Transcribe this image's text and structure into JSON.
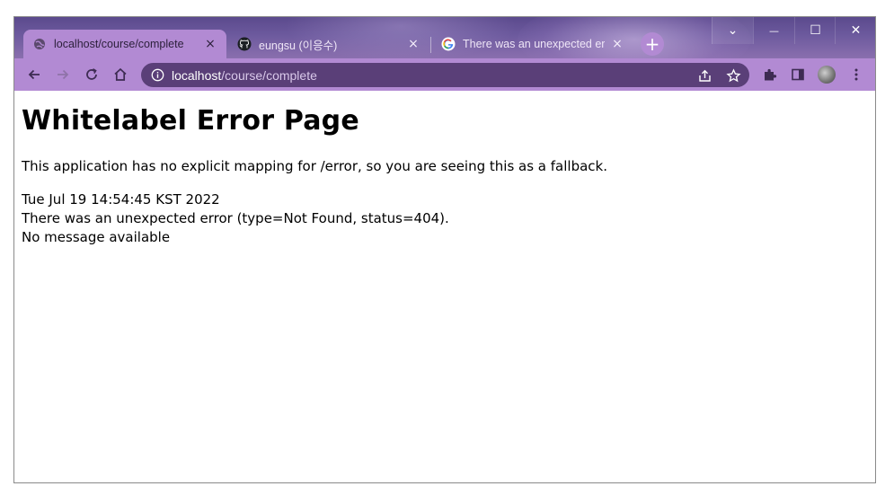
{
  "browser": {
    "tabs": [
      {
        "title": "localhost/course/complete",
        "close": "×",
        "favicon": "globe-icon",
        "active": true
      },
      {
        "title": "eungsu (이응수)",
        "close": "×",
        "favicon": "github-icon",
        "active": false
      },
      {
        "title": "There was an unexpected erro",
        "close": "×",
        "favicon": "google-icon",
        "active": false
      }
    ],
    "new_tab": "+",
    "window_controls": {
      "tab_search": "⌄",
      "minimize": "—",
      "maximize": "☐",
      "close": "✕"
    },
    "address": {
      "host": "localhost",
      "path": "/course/complete"
    },
    "colors": {
      "frame": "#6d5a9e",
      "toolbar": "#b28ad3",
      "omnibox": "#5a3f78"
    }
  },
  "page": {
    "heading": "Whitelabel Error Page",
    "message": "This application has no explicit mapping for /error, so you are seeing this as a fallback.",
    "timestamp": "Tue Jul 19 14:54:45 KST 2022",
    "error_line": "There was an unexpected error (type=Not Found, status=404).",
    "detail": "No message available"
  }
}
